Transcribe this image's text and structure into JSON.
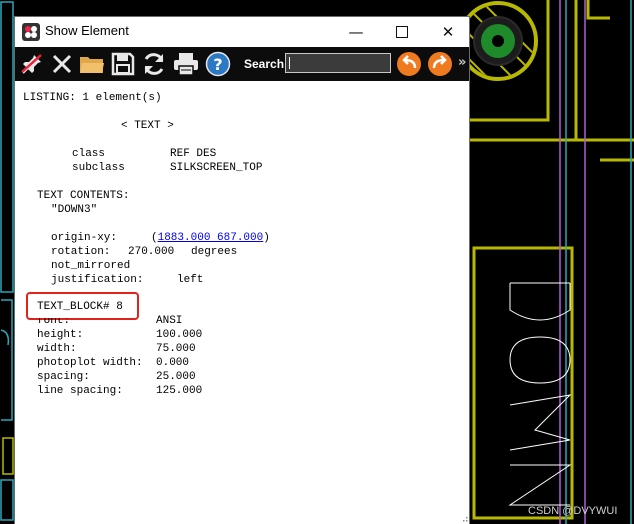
{
  "window": {
    "title": "Show Element",
    "controls": {
      "minimize": "—",
      "close": "✕"
    }
  },
  "toolbar": {
    "search_label": "Search:",
    "search_value": "",
    "more_label": "»",
    "icons": [
      "pin-icon",
      "close-icon",
      "folder-icon",
      "save-icon",
      "refresh-icon",
      "print-icon",
      "help-icon",
      "search-prev-icon",
      "search-next-icon"
    ]
  },
  "listing": {
    "header": "LISTING: 1 element(s)",
    "element_type": "< TEXT >",
    "class_label": "class",
    "class_value": "REF DES",
    "subclass_label": "subclass",
    "subclass_value": "SILKSCREEN_TOP",
    "text_contents_label": "TEXT CONTENTS:",
    "text_contents_value": "\"DOWN3\"",
    "origin_label": "origin-xy:",
    "origin_open": "(",
    "origin_value": "1883.000 687.000",
    "origin_close": ")",
    "rotation_label": "rotation:",
    "rotation_value": "270.000",
    "rotation_unit": "degrees",
    "mirror_status": "not_mirrored",
    "justification_label": "justification:",
    "justification_value": "left",
    "text_block_label": "TEXT_BLOCK# 8",
    "font_label": "font:",
    "font_value": "ANSI",
    "height_label": "height:",
    "height_value": "100.000",
    "width_label": "width:",
    "width_value": "75.000",
    "photoplot_label": "photoplot width:",
    "photoplot_value": "0.000",
    "spacing_label": "spacing:",
    "spacing_value": "25.000",
    "line_spacing_label": "line spacing:",
    "line_spacing_value": "125.000"
  },
  "watermark": "CSDN @DVYWUI",
  "colors": {
    "silkscreen": "#b8b800",
    "trace_purple": "#b05cd9",
    "cyan_outline": "#2aa8b8",
    "pad_green": "#1f8a2a",
    "highlight_box": "#e2231a",
    "toolbar_bg": "#0c0c0c",
    "link": "#0000ee"
  }
}
